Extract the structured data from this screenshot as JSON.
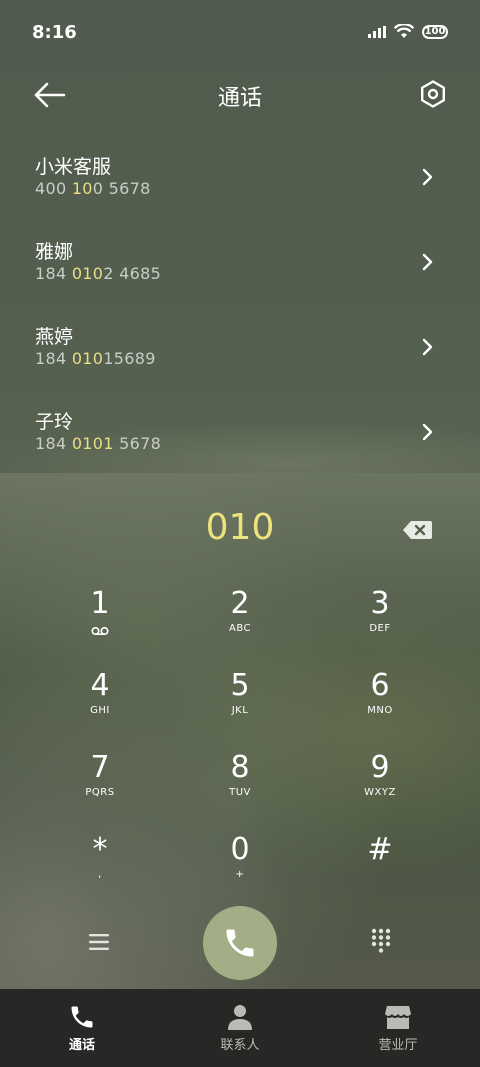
{
  "status_bar": {
    "time": "8:16",
    "battery": "100"
  },
  "header": {
    "title": "通话"
  },
  "contacts": [
    {
      "name": "小米客服",
      "number_parts": [
        "400 ",
        "10",
        "0 5678"
      ]
    },
    {
      "name": "雅娜",
      "number_parts": [
        "184 ",
        "010",
        "2 4685"
      ]
    },
    {
      "name": "燕婷",
      "number_parts": [
        "184 ",
        "010",
        "15689"
      ]
    },
    {
      "name": "子玲",
      "number_parts": [
        "184 ",
        "0101",
        " 5678"
      ]
    }
  ],
  "dial": {
    "number": "010"
  },
  "keypad": [
    {
      "digit": "1",
      "letters": ""
    },
    {
      "digit": "2",
      "letters": "ABC"
    },
    {
      "digit": "3",
      "letters": "DEF"
    },
    {
      "digit": "4",
      "letters": "GHI"
    },
    {
      "digit": "5",
      "letters": "JKL"
    },
    {
      "digit": "6",
      "letters": "MNO"
    },
    {
      "digit": "7",
      "letters": "PQRS"
    },
    {
      "digit": "8",
      "letters": "TUV"
    },
    {
      "digit": "9",
      "letters": "WXYZ"
    },
    {
      "digit": "*",
      "letters": ","
    },
    {
      "digit": "0",
      "letters": "+"
    },
    {
      "digit": "#",
      "letters": ""
    }
  ],
  "tabs": [
    {
      "label": "通话",
      "icon": "phone-icon",
      "active": true
    },
    {
      "label": "联系人",
      "icon": "person-icon",
      "active": false
    },
    {
      "label": "营业厅",
      "icon": "store-icon",
      "active": false
    }
  ],
  "colors": {
    "highlight": "#e7de86",
    "call_button": "#a4ae86",
    "tab_bar": "#272826"
  }
}
